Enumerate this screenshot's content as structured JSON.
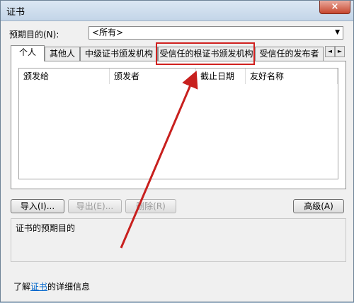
{
  "window": {
    "title": "证书",
    "close_glyph": "×"
  },
  "purpose": {
    "label": "预期目的(N):",
    "selected": "<所有>",
    "arrow": "▼"
  },
  "tabs": [
    {
      "label": "个人",
      "active": true
    },
    {
      "label": "其他人",
      "active": false
    },
    {
      "label": "中级证书颁发机构",
      "active": false
    },
    {
      "label": "受信任的根证书颁发机构",
      "active": false
    },
    {
      "label": "受信任的发布者",
      "active": false
    }
  ],
  "tab_scroll": {
    "left": "◄",
    "right": "►"
  },
  "list": {
    "columns": [
      "颁发给",
      "颁发者",
      "截止日期",
      "友好名称"
    ],
    "rows": []
  },
  "buttons": {
    "import": "导入(I)...",
    "export": "导出(E)...",
    "remove": "删除(R)",
    "advanced": "高级(A)"
  },
  "purpose_box": {
    "title": "证书的预期目的"
  },
  "footer": {
    "learn_prefix": "了解",
    "learn_link": "证书",
    "learn_suffix": "的详细信息"
  },
  "annotation": {
    "highlight_color": "#d0201e"
  }
}
